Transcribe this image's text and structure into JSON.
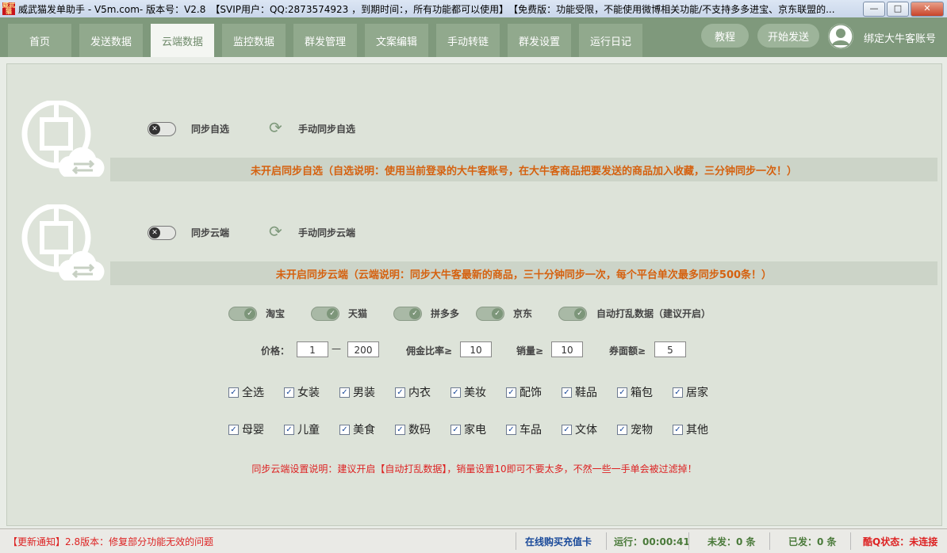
{
  "window": {
    "logo_text": "威武猫",
    "title": "威武猫发单助手 - V5m.com- 版本号：V2.8　【SVIP用户：QQ:2873574923 ，到期时间：，所有功能都可以使用】　【免费版：功能受限，不能使用微博相关功能/不支持多多进宝、京东联盟的...",
    "minimize": "—",
    "maximize": "□",
    "close": "✕"
  },
  "nav": {
    "tabs": [
      "首页",
      "发送数据",
      "云端数据",
      "监控数据",
      "群发管理",
      "文案编辑",
      "手动转链",
      "群发设置",
      "运行日记"
    ],
    "active_index": 2,
    "tutorial": "教程",
    "start_send": "开始发送",
    "bind_account": "绑定大牛客账号"
  },
  "sync_favorites": {
    "toggle_label": "同步自选",
    "manual_label": "手动同步自选",
    "enabled": false,
    "notice": "未开启同步自选（自选说明：使用当前登录的大牛客账号，在大牛客商品把要发送的商品加入收藏，三分钟同步一次！）"
  },
  "sync_cloud": {
    "toggle_label": "同步云端",
    "manual_label": "手动同步云端",
    "enabled": false,
    "notice": "未开启同步云端（云端说明：同步大牛客最新的商品，三十分钟同步一次，每个平台单次最多同步500条！）"
  },
  "platforms": [
    {
      "label": "淘宝",
      "enabled": true
    },
    {
      "label": "天猫",
      "enabled": true
    },
    {
      "label": "拼多多",
      "enabled": true
    },
    {
      "label": "京东",
      "enabled": true
    },
    {
      "label": "自动打乱数据（建议开启）",
      "enabled": true
    }
  ],
  "filters": {
    "price_label": "价格：",
    "price_min": "1",
    "price_dash": "—",
    "price_max": "200",
    "commission_label": "佣金比率≥",
    "commission": "10",
    "sales_label": "销量≥",
    "sales": "10",
    "coupon_label": "券面额≥",
    "coupon": "5"
  },
  "categories_row1": [
    "全选",
    "女装",
    "男装",
    "内衣",
    "美妆",
    "配饰",
    "鞋品",
    "箱包",
    "居家"
  ],
  "categories_row2": [
    "母婴",
    "儿童",
    "美食",
    "数码",
    "家电",
    "车品",
    "文体",
    "宠物",
    "其他"
  ],
  "footnote": "同步云端设置说明：建议开启【自动打乱数据】，销量设置10即可不要太多，不然一些一手单会被过滤掉！",
  "status": {
    "update_notice": "【更新通知】2.8版本：修复部分功能无效的问题",
    "buy_card": "在线购买充值卡",
    "running": "运行：00:00:41",
    "unsent": "未发：0 条",
    "sent": "已发：0 条",
    "kuq_status": "酷Q状态：未连接"
  },
  "colors": {
    "nav_bg": "#7f997c",
    "notice_text": "#d5610f",
    "footnote_text": "#dd2222",
    "link_blue": "#1a4a9a"
  }
}
